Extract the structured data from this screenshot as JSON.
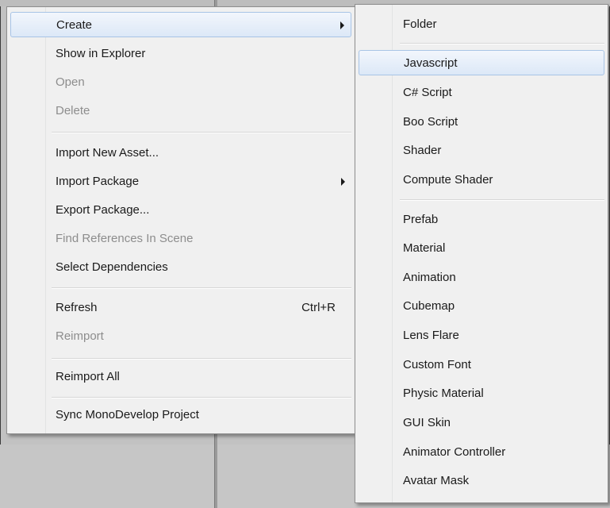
{
  "context_menu": {
    "create": "Create",
    "show_in_explorer": "Show in Explorer",
    "open": "Open",
    "delete": "Delete",
    "import_new_asset": "Import New Asset...",
    "import_package": "Import Package",
    "export_package": "Export Package...",
    "find_references": "Find References In Scene",
    "select_dependencies": "Select Dependencies",
    "refresh": "Refresh",
    "refresh_shortcut": "Ctrl+R",
    "reimport": "Reimport",
    "reimport_all": "Reimport All",
    "sync_monodevelop": "Sync MonoDevelop Project"
  },
  "create_submenu": {
    "folder": "Folder",
    "javascript": "Javascript",
    "csharp_script": "C# Script",
    "boo_script": "Boo Script",
    "shader": "Shader",
    "compute_shader": "Compute Shader",
    "prefab": "Prefab",
    "material": "Material",
    "animation": "Animation",
    "cubemap": "Cubemap",
    "lens_flare": "Lens Flare",
    "custom_font": "Custom Font",
    "physic_material": "Physic Material",
    "gui_skin": "GUI Skin",
    "animator_controller": "Animator Controller",
    "avatar_mask": "Avatar Mask"
  },
  "colors": {
    "highlight_border": "#a8c4e6",
    "highlight_fill": "#dce8f7",
    "menu_bg": "#f0f0f0",
    "disabled_text": "#8d8d8d"
  }
}
